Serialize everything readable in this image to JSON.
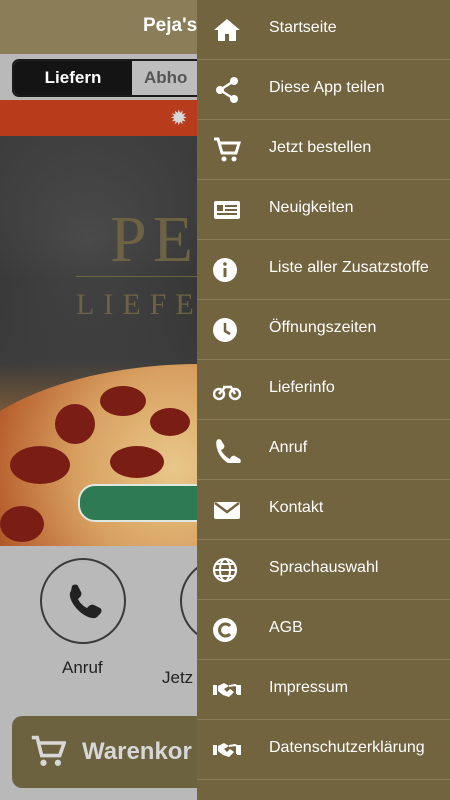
{
  "app": {
    "title": "Peja's",
    "tabs": {
      "active": "Liefern",
      "inactive": "Abho"
    },
    "hero_logo": {
      "big": "PE",
      "sub": "LIEFE"
    },
    "actions": [
      {
        "label": "Anruf",
        "icon": "phone-icon"
      },
      {
        "label": "Jetz",
        "icon": "order-icon"
      }
    ],
    "warenkorb": "Warenkor"
  },
  "drawer": {
    "items": [
      {
        "label": "Startseite",
        "icon": "home-icon"
      },
      {
        "label": "Diese App teilen",
        "icon": "share-icon"
      },
      {
        "label": "Jetzt bestellen",
        "icon": "cart-icon"
      },
      {
        "label": "Neuigkeiten",
        "icon": "news-icon"
      },
      {
        "label": "Liste aller Zusatzstoffe",
        "icon": "info-icon"
      },
      {
        "label": "Öffnungszeiten",
        "icon": "clock-icon"
      },
      {
        "label": "Lieferinfo",
        "icon": "motorcycle-icon"
      },
      {
        "label": "Anruf",
        "icon": "phone-icon"
      },
      {
        "label": "Kontakt",
        "icon": "envelope-icon"
      },
      {
        "label": "Sprachauswahl",
        "icon": "globe-icon"
      },
      {
        "label": "AGB",
        "icon": "copyright-icon"
      },
      {
        "label": "Impressum",
        "icon": "handshake-icon"
      },
      {
        "label": "Datenschutzerklärung",
        "icon": "handshake-icon"
      }
    ]
  },
  "colors": {
    "drawer_bg": "#72643f",
    "appbar_bg": "#8a7d58",
    "banner": "#b83c1c",
    "hero_button": "#2e7a54"
  }
}
